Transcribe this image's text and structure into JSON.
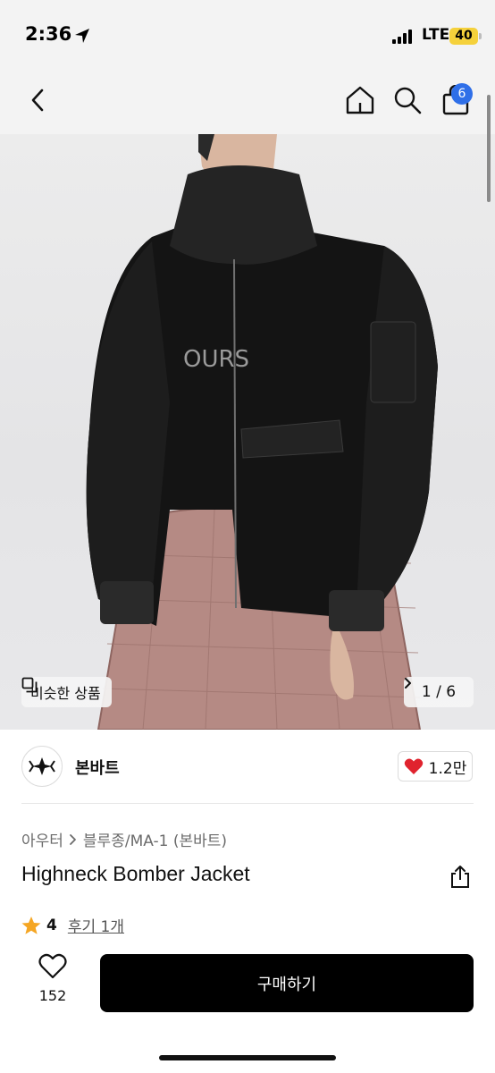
{
  "status_bar": {
    "time": "2:36",
    "network": "LTE",
    "battery": "40",
    "icons": [
      "location-arrow-icon",
      "signal-bars-icon"
    ]
  },
  "nav": {
    "icons": [
      "back-chevron-icon",
      "home-icon",
      "search-icon",
      "shopping-bag-icon"
    ],
    "cart_count": "6"
  },
  "gallery": {
    "similar_label": "비슷한 상품",
    "page_counter": "1 / 6",
    "current_index": 1,
    "total": 6
  },
  "store": {
    "name": "본바트",
    "likes": "1.2만",
    "like_color": "#e0232e"
  },
  "product": {
    "breadcrumb": [
      "아우터",
      "블루종/MA-1 (본바트)"
    ],
    "title": "Highneck Bomber Jacket",
    "rating": "4",
    "review_label": "후기 1개",
    "star_color": "#f5a623"
  },
  "actions": {
    "wishlist_count": "152",
    "buy_label": "구매하기"
  }
}
